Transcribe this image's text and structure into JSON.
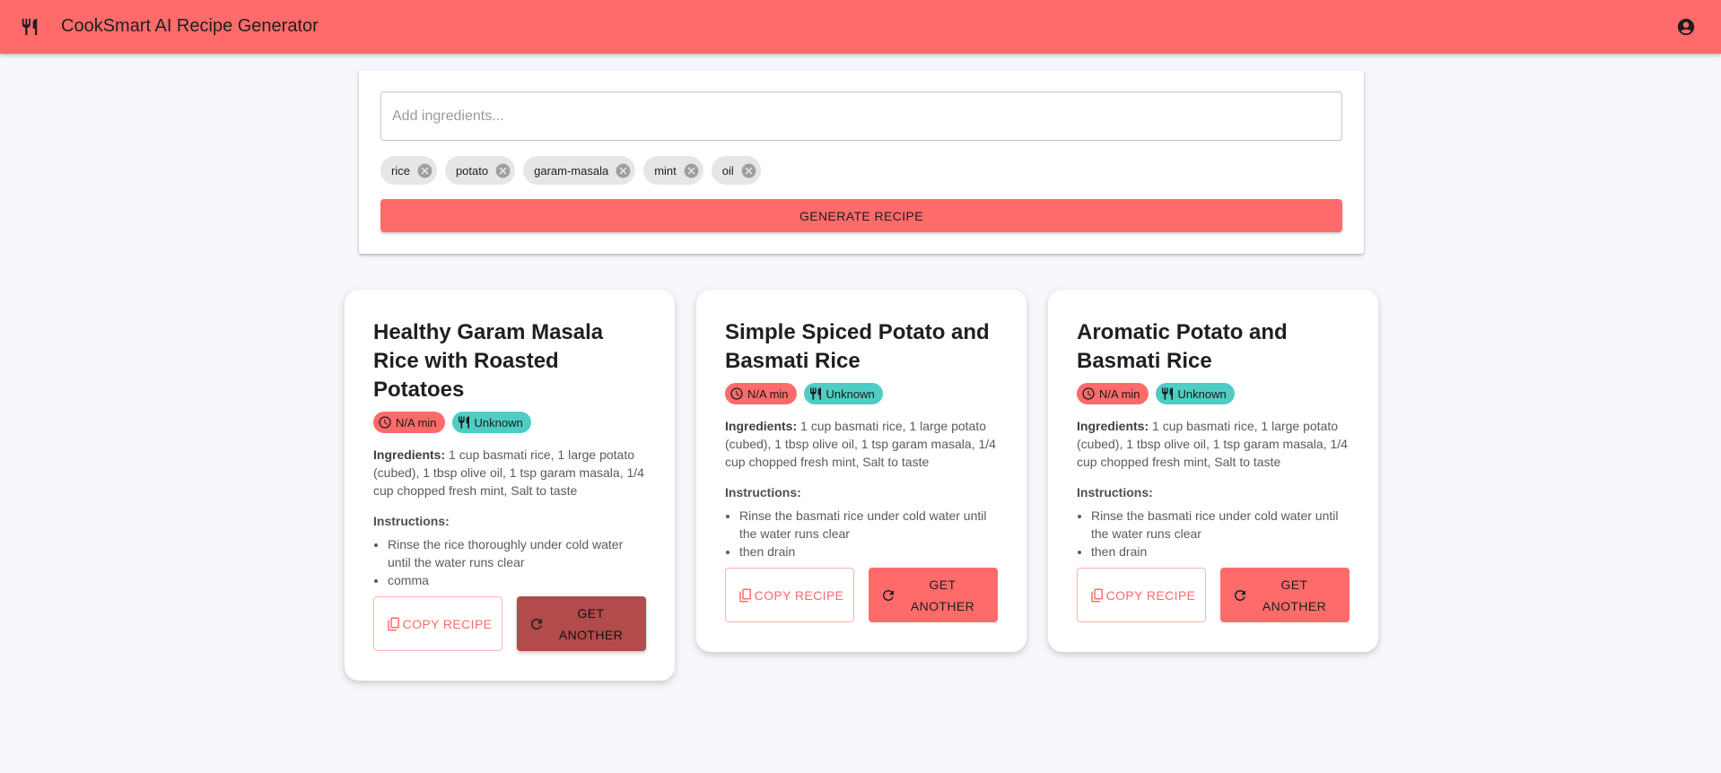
{
  "app": {
    "title": "CookSmart AI Recipe Generator",
    "colors": {
      "primary": "#ff6b6b",
      "secondary": "#4ecdc4",
      "primary_dark": "#b24b4b",
      "background": "#f6f7fb"
    }
  },
  "search": {
    "placeholder": "Add ingredients...",
    "value": "",
    "chips": [
      "rice",
      "potato",
      "garam-masala",
      "mint",
      "oil"
    ],
    "generate_label": "GENERATE RECIPE"
  },
  "recipes": [
    {
      "title": "Healthy Garam Masala Rice with Roasted Potatoes",
      "time": "N/A min",
      "cuisine": "Unknown",
      "ingredients_label": "Ingredients:",
      "ingredients": "1 cup basmati rice, 1 large potato (cubed), 1 tbsp olive oil, 1 tsp garam masala, 1/4 cup chopped fresh mint, Salt to taste",
      "instructions_label": "Instructions:",
      "instructions": [
        "Rinse the rice thoroughly under cold water until the water runs clear",
        "comma"
      ],
      "copy_label": "COPY RECIPE",
      "another_label": "GET ANOTHER"
    },
    {
      "title": "Simple Spiced Potato and Basmati Rice",
      "time": "N/A min",
      "cuisine": "Unknown",
      "ingredients_label": "Ingredients:",
      "ingredients": "1 cup basmati rice, 1 large potato (cubed), 1 tbsp olive oil, 1 tsp garam masala, 1/4 cup chopped fresh mint, Salt to taste",
      "instructions_label": "Instructions:",
      "instructions": [
        "Rinse the basmati rice under cold water until the water runs clear",
        "then drain"
      ],
      "copy_label": "COPY RECIPE",
      "another_label": "GET ANOTHER"
    },
    {
      "title": "Aromatic Potato and Basmati Rice",
      "time": "N/A min",
      "cuisine": "Unknown",
      "ingredients_label": "Ingredients:",
      "ingredients": "1 cup basmati rice, 1 large potato (cubed), 1 tbsp olive oil, 1 tsp garam masala, 1/4 cup chopped fresh mint, Salt to taste",
      "instructions_label": "Instructions:",
      "instructions": [
        "Rinse the basmati rice under cold water until the water runs clear",
        "then drain"
      ],
      "copy_label": "COPY RECIPE",
      "another_label": "GET ANOTHER"
    }
  ],
  "icons": {
    "logo": "restaurant-icon",
    "account": "account-circle-icon",
    "chip_delete": "cancel-icon",
    "time": "clock-icon",
    "cuisine": "restaurant-icon",
    "copy": "copy-icon",
    "refresh": "refresh-icon"
  }
}
